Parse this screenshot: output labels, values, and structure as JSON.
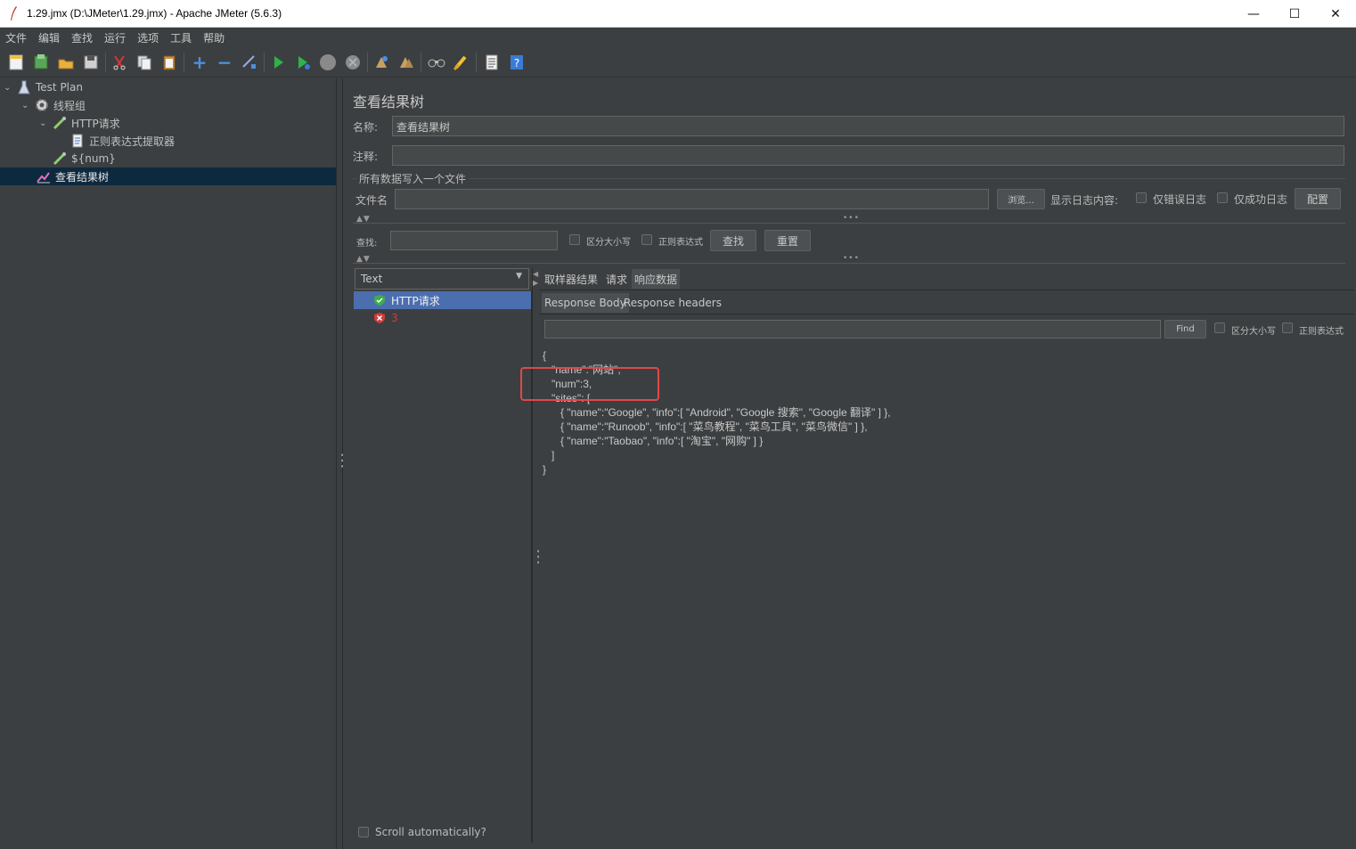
{
  "window": {
    "title": "1.29.jmx (D:\\JMeter\\1.29.jmx) - Apache JMeter (5.6.3)",
    "minimize": "—",
    "maximize": "☐",
    "close": "✕"
  },
  "menu": [
    "文件",
    "编辑",
    "查找",
    "运行",
    "选项",
    "工具",
    "帮助"
  ],
  "tree": {
    "items": [
      {
        "label": "Test Plan"
      },
      {
        "label": "线程组"
      },
      {
        "label": "HTTP请求"
      },
      {
        "label": "正则表达式提取器"
      },
      {
        "label": "${num}"
      },
      {
        "label": "查看结果树"
      }
    ]
  },
  "panel": {
    "heading": "查看结果树",
    "name_label": "名称:",
    "name_value": "查看结果树",
    "comment_label": "注释:",
    "comment_value": "",
    "file_group": "所有数据写入一个文件",
    "filename_label": "文件名",
    "filename_value": "",
    "browse": "浏览...",
    "log_label": "显示日志内容:",
    "errors_only": "仅错误日志",
    "success_only": "仅成功日志",
    "configure": "配置",
    "search_label": "查找:",
    "search_value": "",
    "case_sensitive": "区分大小写",
    "regex": "正则表达式",
    "find_btn": "查找",
    "reset_btn": "重置"
  },
  "results": {
    "renderer": "Text",
    "samples": [
      {
        "label": "HTTP请求",
        "status": "success"
      },
      {
        "label": "3",
        "status": "error"
      }
    ],
    "scroll_auto": "Scroll automatically?"
  },
  "tabs": [
    "取样器结果",
    "请求",
    "响应数据"
  ],
  "subtabs": [
    "Response Body",
    "Response headers"
  ],
  "response": {
    "find_value": "",
    "find_btn": "Find",
    "case_sensitive": "区分大小写",
    "regex": "正则表达式",
    "body": "{\n   \"name\":\"网站\",\n   \"num\":3,\n   \"sites\": [\n      { \"name\":\"Google\", \"info\":[ \"Android\", \"Google 搜索\", \"Google 翻译\" ] },\n      { \"name\":\"Runoob\", \"info\":[ \"菜鸟教程\", \"菜鸟工具\", \"菜鸟微信\" ] },\n      { \"name\":\"Taobao\", \"info\":[ \"淘宝\", \"网购\" ] }\n   ]\n}"
  },
  "colors": {
    "background": "#3c3f41",
    "selection": "#0d293e",
    "sample_selected": "#4b6eaf",
    "highlight_box": "#e04848",
    "success": "#3fae4a",
    "error": "#d33b3b"
  }
}
